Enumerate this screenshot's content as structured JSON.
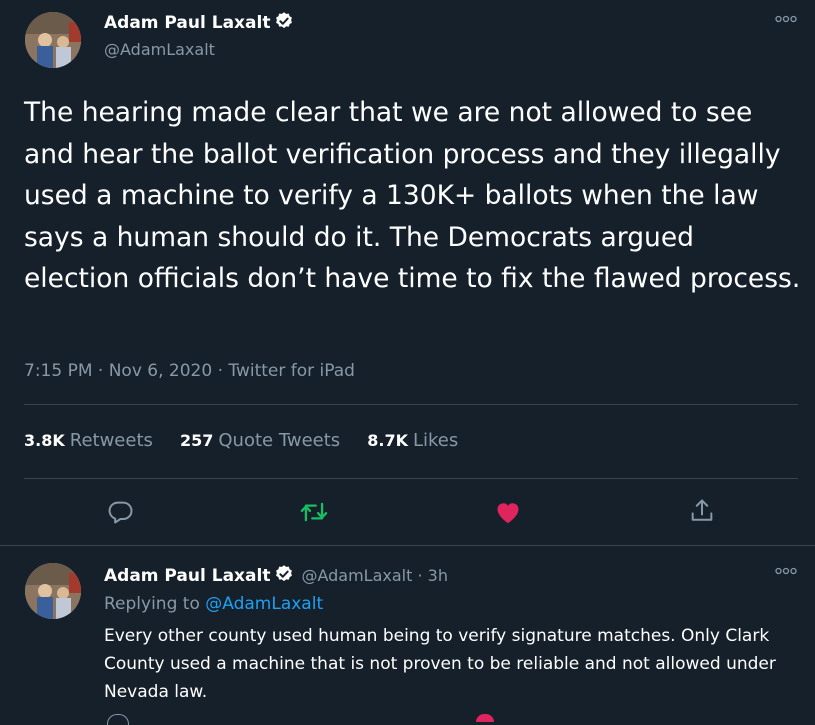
{
  "main_tweet": {
    "author_name": "Adam Paul Laxalt",
    "author_handle": "@AdamLaxalt",
    "more_icon": "more-dots-icon",
    "text": "The hearing made clear that we are not allowed to see and hear the ballot verification process and they illegally used a machine to verify a 130K+ ballots when the law says a human should do it. The Democrats argued election officials don’t have time to fix the flawed process.",
    "meta": "7:15 PM · Nov 6, 2020 · Twitter for iPad",
    "stats": [
      {
        "count": "3.8K",
        "label": "Retweets"
      },
      {
        "count": "257",
        "label": "Quote Tweets"
      },
      {
        "count": "8.7K",
        "label": "Likes"
      }
    ],
    "actions": {
      "reply_icon": "reply-icon",
      "retweet_icon": "retweet-icon",
      "like_icon": "heart-icon",
      "share_icon": "share-icon"
    }
  },
  "reply_tweet": {
    "author_name": "Adam Paul Laxalt",
    "author_handle_time": "@AdamLaxalt · 3h",
    "replying_prefix": "Replying to",
    "replying_handle": "@AdamLaxalt",
    "text": "Every other county used human being to verify signature matches. Only Clark County used a machine that is not proven to be reliable and not allowed under Nevada law."
  },
  "colors": {
    "background": "#15202b",
    "muted": "#8899a6",
    "accent": "#1da1f2",
    "retweet": "#17bf63",
    "like": "#e0245e",
    "divider": "#38444d"
  }
}
